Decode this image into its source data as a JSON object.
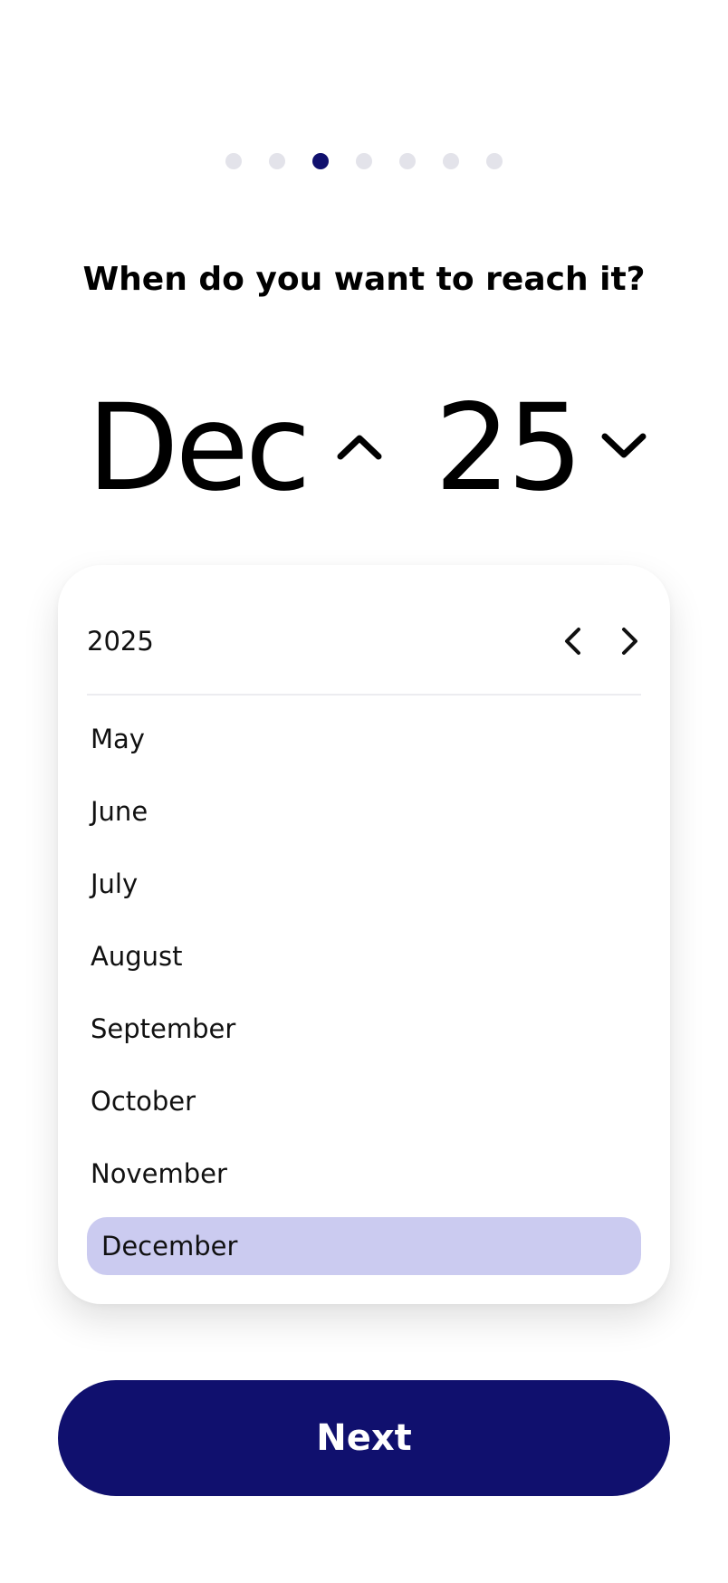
{
  "progress": {
    "total_steps": 7,
    "current_step": 3
  },
  "question": "When do you want to reach it?",
  "selected_date": {
    "month": "Dec",
    "year": "25"
  },
  "picker": {
    "year": "2025",
    "months": [
      "May",
      "June",
      "July",
      "August",
      "September",
      "October",
      "November",
      "December"
    ],
    "selected_month": "December"
  },
  "next_button": {
    "label": "Next"
  },
  "colors": {
    "accent": "#10106e",
    "selected_highlight": "#cbcbf0",
    "inactive_dot": "#e3e3ea"
  },
  "icons": {
    "month_toggle": "chevron-up-icon",
    "year_toggle": "chevron-down-icon",
    "prev_year": "chevron-left-icon",
    "next_year": "chevron-right-icon"
  }
}
